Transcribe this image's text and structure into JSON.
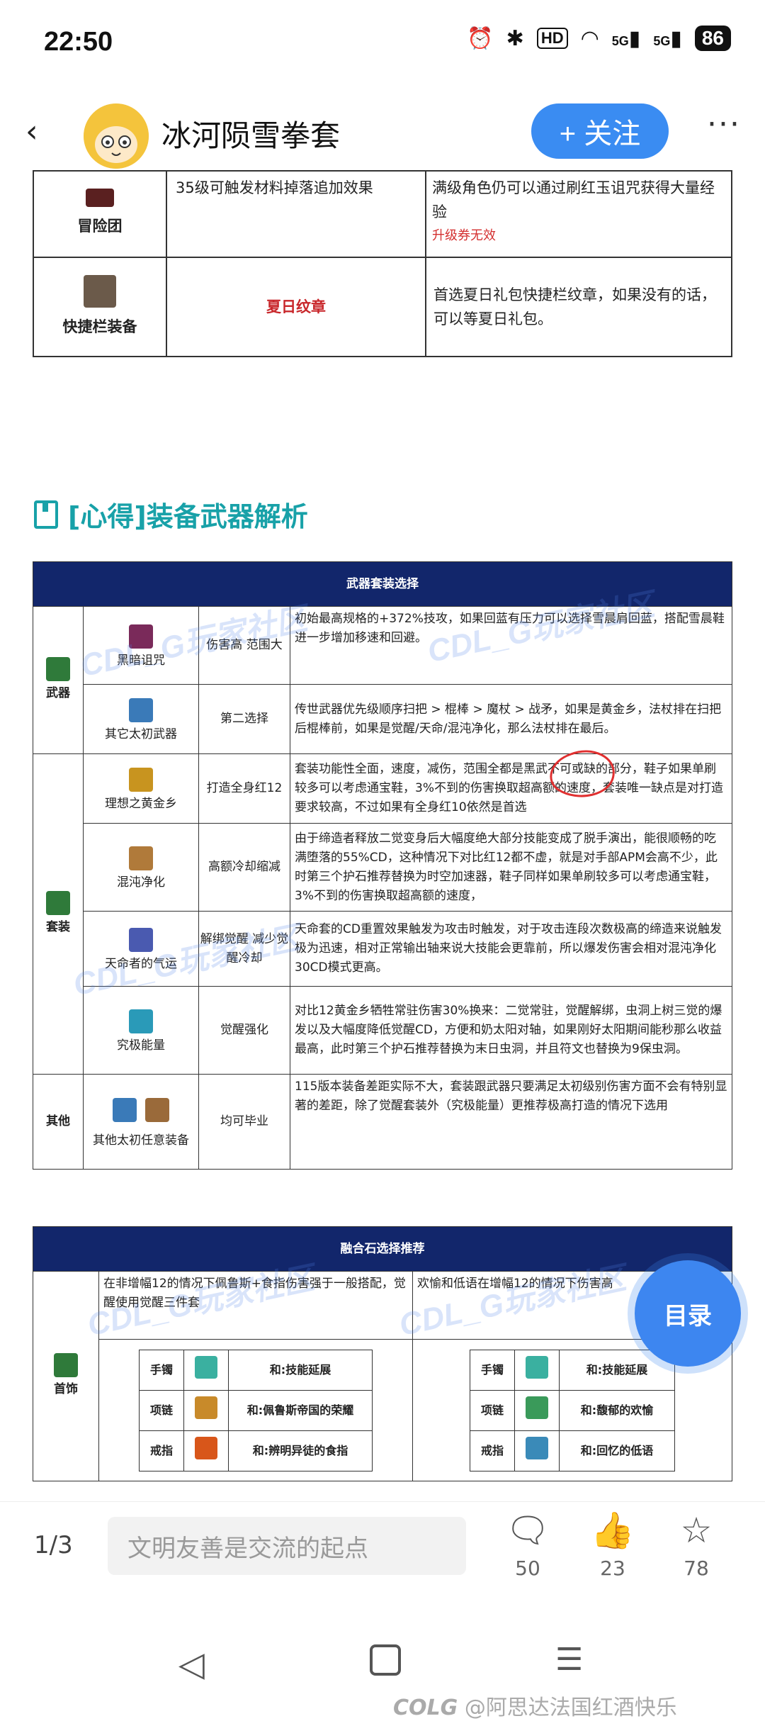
{
  "status_bar": {
    "time": "22:50",
    "hd": "HD",
    "net1": "5G",
    "net2": "5G",
    "battery": "86"
  },
  "header": {
    "title": "冰河陨雪拳套",
    "follow_label": "+ 关注",
    "more": "···"
  },
  "top_table": {
    "rows": [
      {
        "category": "冒险团",
        "middle": "35级可触发材料掉落追加效果",
        "right": "满级角色仍可以通过刷红玉诅咒获得大量经验",
        "right_note": "升级券无效"
      },
      {
        "category": "快捷栏装备",
        "middle": "夏日纹章",
        "right": "首选夏日礼包快捷栏纹章，如果没有的话，可以等夏日礼包。"
      }
    ]
  },
  "section_title": "[心得]装备武器解析",
  "weapon_table": {
    "title": "武器套装选择",
    "categories": [
      "武器",
      "套装",
      "其他"
    ],
    "rows": [
      {
        "item": "黑暗诅咒",
        "effect": "伤害高 范围大",
        "desc": "初始最高规格的+372%技攻，如果回蓝有压力可以选择雪晨肩回蓝，搭配雪晨鞋进一步增加移速和回避。"
      },
      {
        "item": "其它太初武器",
        "effect": "第二选择",
        "desc": "传世武器优先级顺序扫把 > 棍棒 > 魔杖 > 战矛，如果是黄金乡，法杖排在扫把后棍棒前，如果是觉醒/天命/混沌净化，那么法杖排在最后。"
      },
      {
        "item": "理想之黄金乡",
        "effect": "打造全身红12",
        "desc": "套装功能性全面，速度，减伤，范围全都是黑武不可或缺的部分，鞋子如果单刷较多可以考虑通宝鞋，3%不到的伤害换取超高额的速度，套装唯一缺点是对打造要求较高，不过如果有全身红10依然是首选"
      },
      {
        "item": "混沌净化",
        "effect": "高额冷却缩减",
        "desc": "由于缔造者释放二觉变身后大幅度绝大部分技能变成了脱手演出，能很顺畅的吃满堕落的55%CD，这种情况下对比红12都不虚，就是对手部APM会高不少，此时第三个护石推荐替换为时空加速器，鞋子同样如果单刷较多可以考虑通宝鞋，3%不到的伤害换取超高额的速度，"
      },
      {
        "item": "天命者的气运",
        "effect": "解绑觉醒 减少觉醒冷却",
        "desc": "天命套的CD重置效果触发为攻击时触发，对于攻击连段次数极高的缔造来说触发极为迅速，相对正常输出轴来说大技能会更靠前，所以爆发伤害会相对混沌净化30CD模式更高。"
      },
      {
        "item": "究极能量",
        "effect": "觉醒强化",
        "desc": "对比12黄金乡牺牲常驻伤害30%换来：二觉常驻，觉醒解绑，虫洞上树三觉的爆发以及大幅度降低觉醒CD，方便和奶太阳对轴，如果刚好太阳期间能秒那么收益最高，此时第三个护石推荐替换为末日虫洞，并且符文也替换为9保虫洞。"
      },
      {
        "item": "其他太初任意装备",
        "effect": "均可毕业",
        "desc": "115版本装备差距实际不大，套装跟武器只要满足太初级别伤害方面不会有特别显著的差距，除了觉醒套装外（究极能量）更推荐极高打造的情况下选用"
      }
    ]
  },
  "fusion_table": {
    "title": "融合石选择推荐",
    "category": "首饰",
    "left_note": "在非增幅12的情况下佩鲁斯+食指伤害强于一般搭配，觉醒使用觉醒三件套",
    "right_note": "欢愉和低语在增幅12的情况下伤害高",
    "left_slots": [
      {
        "slot": "手镯",
        "stone": "和:技能延展"
      },
      {
        "slot": "项链",
        "stone": "和:佩鲁斯帝国的荣耀"
      },
      {
        "slot": "戒指",
        "stone": "和:辨明异徒的食指"
      }
    ],
    "right_slots": [
      {
        "slot": "手镯",
        "stone": "和:技能延展"
      },
      {
        "slot": "项链",
        "stone": "和:馥郁的欢愉"
      },
      {
        "slot": "戒指",
        "stone": "和:回忆的低语"
      }
    ]
  },
  "watermark_text": "CDL_G玩家社区",
  "toc_label": "目录",
  "bottom_bar": {
    "page": "1/3",
    "comment_placeholder": "文明友善是交流的起点",
    "comments": "50",
    "likes": "23",
    "favorites": "78"
  },
  "credit": "@阿思达法国红酒快乐",
  "credit_logo": "COLG"
}
